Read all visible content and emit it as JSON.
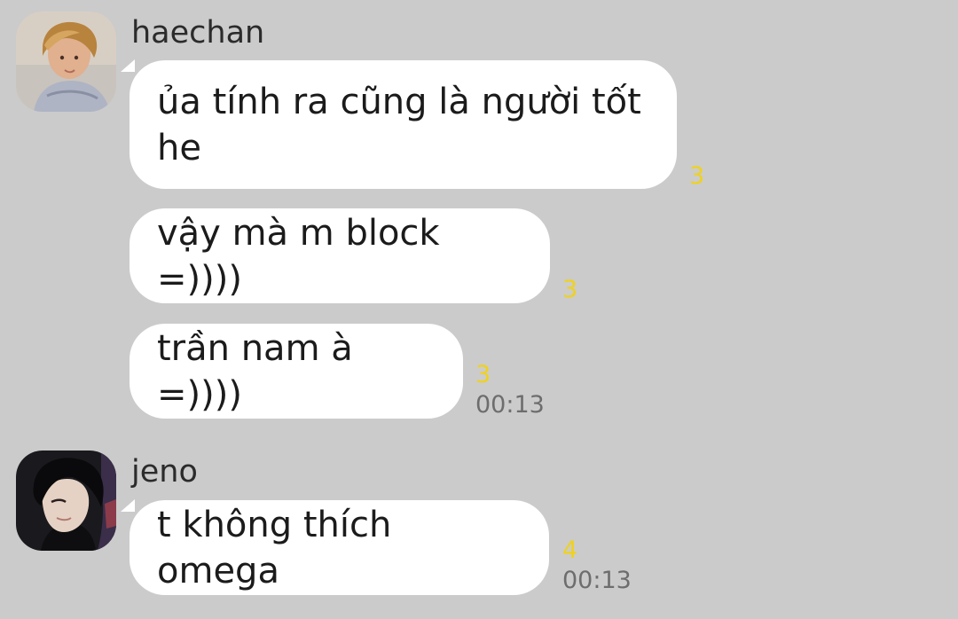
{
  "messages": [
    {
      "sender": "haechan",
      "bubbles": [
        {
          "lines": [
            "ủa tính ra cũng là người tốt",
            "he"
          ],
          "unread": "3"
        },
        {
          "lines": [
            "vậy mà m block =))))"
          ],
          "unread": "3"
        },
        {
          "lines": [
            "trần nam à =))))"
          ],
          "unread": "3",
          "time": "00:13"
        }
      ]
    },
    {
      "sender": "jeno",
      "bubbles": [
        {
          "lines": [
            "t không thích omega"
          ],
          "unread": "4",
          "time": "00:13"
        }
      ]
    }
  ],
  "colors": {
    "background": "#cbcbcb",
    "bubble": "#ffffff",
    "unread": "#f0d21c",
    "time": "#6d6d6d"
  }
}
